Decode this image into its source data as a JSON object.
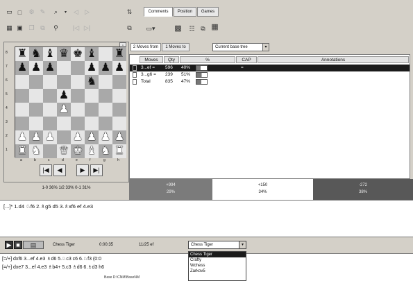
{
  "toolbar": {
    "row1_icons": [
      "new-board-icon",
      "window-icon",
      "engine-icon",
      "document-icon",
      "search-icon",
      "arrow-down-icon",
      "back-icon",
      "forward-icon",
      "flip-icon"
    ],
    "row2_icons": [
      "board-icon",
      "grid-icon",
      "stack-icon",
      "copy-icon",
      "tree-icon",
      "nav-start-icon",
      "nav-end-icon",
      "copy-window-icon"
    ]
  },
  "top_tabs": [
    "Comments",
    "Position",
    "Games"
  ],
  "board": {
    "ranks": [
      [
        "r",
        "n",
        "b",
        "q",
        "k",
        "b",
        "",
        "r"
      ],
      [
        "p",
        "p",
        "p",
        "",
        "",
        "p",
        "p",
        "p"
      ],
      [
        "",
        "",
        "",
        "",
        "",
        "n",
        "",
        ""
      ],
      [
        "",
        "",
        "",
        "p",
        "",
        "",
        "",
        ""
      ],
      [
        "",
        "",
        "",
        "P",
        "",
        "",
        "",
        ""
      ],
      [
        "",
        "",
        "",
        "",
        "",
        "",
        "",
        ""
      ],
      [
        "P",
        "P",
        "P",
        "",
        "P",
        "P",
        "P",
        "P"
      ],
      [
        "R",
        "N",
        "",
        "Q",
        "K",
        "B",
        "N",
        "R"
      ]
    ],
    "rank_labels": [
      "8",
      "7",
      "6",
      "5",
      "4",
      "3",
      "2",
      "1"
    ],
    "file_labels": [
      "a",
      "b",
      "c",
      "d",
      "e",
      "f",
      "g",
      "h"
    ]
  },
  "nav_buttons": [
    "|◀",
    "◀",
    "▶",
    "▶|"
  ],
  "board_status": "1-0 36%   1/2 33%   0-1 31%",
  "tree": {
    "subtabs": [
      "2 Moves from",
      "1 Moves to"
    ],
    "base_select": "Current base tree",
    "headers": [
      "Moves",
      "Qty",
      "%",
      "CAP",
      "Annotations"
    ],
    "rows": [
      {
        "move": "3...ef =",
        "qty": "596",
        "pct": "40%",
        "pct_value": 0.4,
        "cap": "="
      },
      {
        "move": "3...g6 =",
        "qty": "239",
        "pct": "51%",
        "pct_value": 0.51,
        "cap": ""
      },
      {
        "move": "Total",
        "qty": "835",
        "pct": "47%",
        "pct_value": 0.47,
        "cap": ""
      }
    ]
  },
  "eval": [
    {
      "top": "+994",
      "bottom": "29%",
      "color": "#7b7b7b"
    },
    {
      "top": "+150",
      "bottom": "34%",
      "color": "#ffffff"
    },
    {
      "top": "-272",
      "bottom": "38%",
      "color": "#585858"
    }
  ],
  "notation": "[...]* 1.d4 ♘f6 2.♗g5 d5 3.♗xf6 ef 4.e3",
  "status_bar": {
    "engine": "Chess Tiger",
    "time": "0:00:35",
    "depth": "11/25 ef",
    "select": "Chess Tiger"
  },
  "analysis": [
    "[=/+] dxf6 3...ef 4.e3 ♗d6 5.♘c3 c6 6.♘f3 (0:0",
    "[=/+] dxe7 3...ef 4.e3 ♗b4+ 5.c3 ♗d6 6.♗d3 h6"
  ],
  "status_line": "Base D:\\CNM\\BaseNM",
  "dropdown_options": [
    "Chess Tiger",
    "Crafty",
    "Wchess",
    "Zarkov5"
  ],
  "selected_option": 0
}
